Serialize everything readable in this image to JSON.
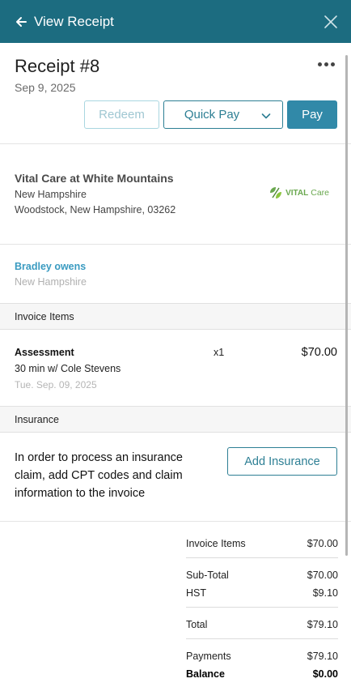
{
  "window": {
    "title": "View Receipt"
  },
  "receipt": {
    "title": "Receipt #8",
    "date": "Sep 9, 2025"
  },
  "actions": {
    "redeem": "Redeem",
    "quick_pay": "Quick Pay",
    "pay": "Pay"
  },
  "clinic": {
    "name": "Vital Care at White Mountains",
    "line1": "New Hampshire",
    "line2": "Woodstock, New Hampshire, 03262",
    "logo_word1": "VITAL",
    "logo_word2": "Care"
  },
  "patient": {
    "name": "Bradley owens",
    "location": "New Hampshire"
  },
  "invoice_items": {
    "heading": "Invoice Items",
    "items": [
      {
        "name": "Assessment",
        "description": "30 min w/ Cole Stevens",
        "date": "Tue. Sep. 09, 2025",
        "qty": "x1",
        "price": "$70.00"
      }
    ]
  },
  "insurance": {
    "heading": "Insurance",
    "text": "In order to process an insurance claim, add CPT codes and claim information to the invoice",
    "button": "Add Insurance"
  },
  "totals": {
    "invoice_items_label": "Invoice Items",
    "invoice_items_value": "$70.00",
    "subtotal_label": "Sub-Total",
    "subtotal_value": "$70.00",
    "hst_label": "HST",
    "hst_value": "$9.10",
    "total_label": "Total",
    "total_value": "$79.10",
    "payments_label": "Payments",
    "payments_value": "$79.10",
    "balance_label": "Balance",
    "balance_value": "$0.00"
  },
  "colors": {
    "header_bg": "#1c6c80",
    "accent": "#3189a8",
    "link": "#3a9bc1",
    "logo_green": "#6aa84f"
  }
}
